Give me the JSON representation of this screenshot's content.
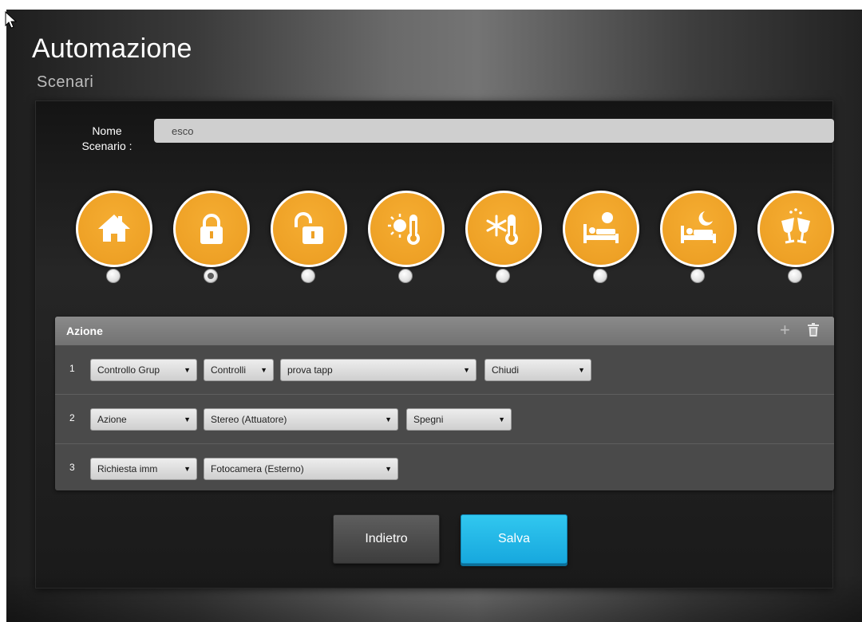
{
  "header": {
    "title": "Automazione",
    "subtitle": "Scenari"
  },
  "form": {
    "name_label_line1": "Nome",
    "name_label_line2": "Scenario :",
    "name_value": "esco"
  },
  "scenario_icons": [
    {
      "icon": "home-icon",
      "selected": false
    },
    {
      "icon": "lock-closed-icon",
      "selected": true
    },
    {
      "icon": "lock-open-icon",
      "selected": false
    },
    {
      "icon": "thermometer-sun-icon",
      "selected": false
    },
    {
      "icon": "thermometer-snow-icon",
      "selected": false
    },
    {
      "icon": "bed-sun-icon",
      "selected": false
    },
    {
      "icon": "bed-moon-icon",
      "selected": false
    },
    {
      "icon": "party-glasses-icon",
      "selected": false
    }
  ],
  "actions": {
    "title": "Azione",
    "rows": [
      {
        "num": "1",
        "selects": [
          "Controllo Grup",
          "Controlli",
          "prova tapp",
          "Chiudi"
        ]
      },
      {
        "num": "2",
        "selects": [
          "Azione",
          "Stereo (Attuatore)",
          "Spegni"
        ]
      },
      {
        "num": "3",
        "selects": [
          "Richiesta imm",
          "Fotocamera (Esterno)"
        ]
      }
    ]
  },
  "buttons": {
    "back": "Indietro",
    "save": "Salva"
  },
  "colors": {
    "accent_orange": "#eea126",
    "save_blue": "#1fb5e6",
    "panel_dark": "#1a1a1a"
  }
}
